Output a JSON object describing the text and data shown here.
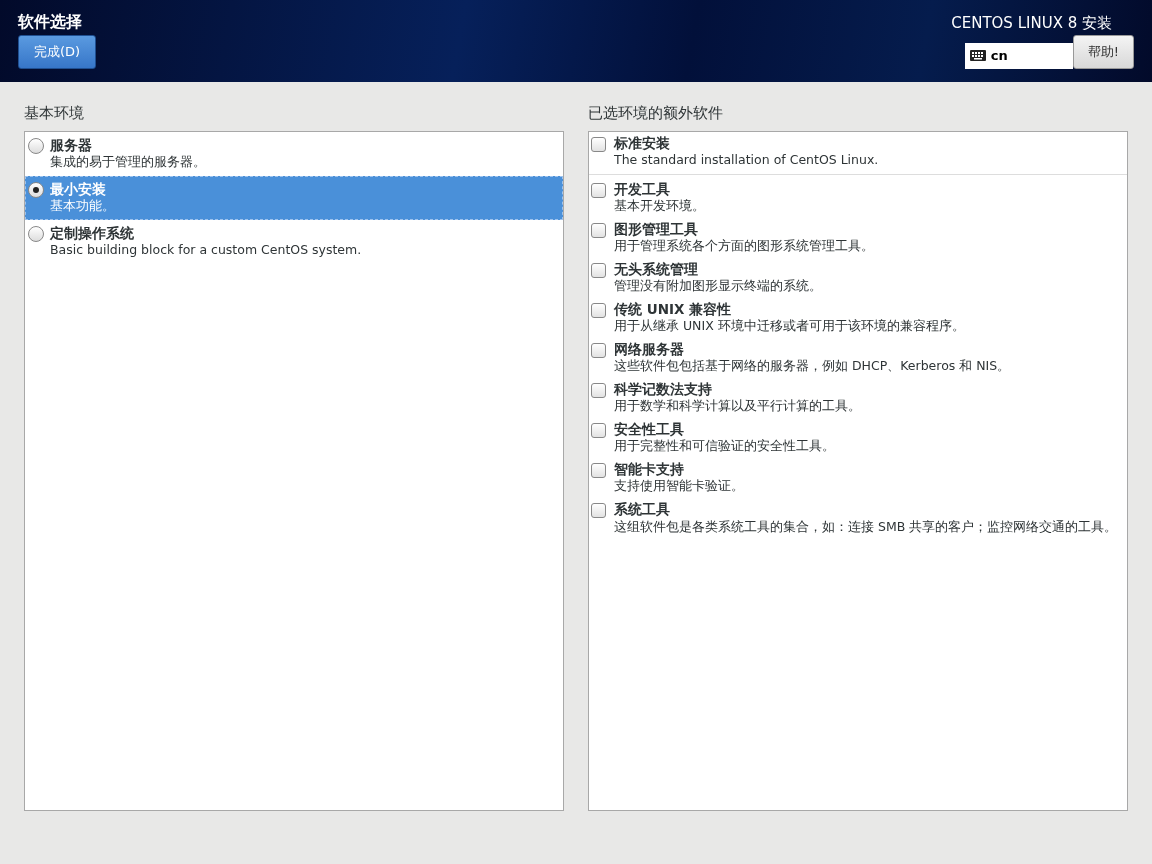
{
  "header": {
    "title": "软件选择",
    "done_button": "完成(D)",
    "product": "CENTOS LINUX 8 安装",
    "keyboard_layout": "cn",
    "help_button": "帮助!"
  },
  "environments": {
    "heading": "基本环境",
    "items": [
      {
        "name": "服务器",
        "description": "集成的易于管理的服务器。",
        "selected": false
      },
      {
        "name": "最小安装",
        "description": "基本功能。",
        "selected": true
      },
      {
        "name": "定制操作系统",
        "description": "Basic building block for a custom CentOS system.",
        "selected": false
      }
    ]
  },
  "addons": {
    "heading": "已选环境的额外软件",
    "groups": [
      [
        {
          "name": "标准安装",
          "description": "The standard installation of CentOS Linux.",
          "checked": false
        }
      ],
      [
        {
          "name": "开发工具",
          "description": "基本开发环境。",
          "checked": false
        },
        {
          "name": "图形管理工具",
          "description": "用于管理系统各个方面的图形系统管理工具。",
          "checked": false
        },
        {
          "name": "无头系统管理",
          "description": "管理没有附加图形显示终端的系统。",
          "checked": false
        },
        {
          "name": "传统 UNIX 兼容性",
          "description": "用于从继承 UNIX 环境中迁移或者可用于该环境的兼容程序。",
          "checked": false
        },
        {
          "name": "网络服务器",
          "description": "这些软件包包括基于网络的服务器，例如 DHCP、Kerberos 和 NIS。",
          "checked": false
        },
        {
          "name": "科学记数法支持",
          "description": "用于数学和科学计算以及平行计算的工具。",
          "checked": false
        },
        {
          "name": "安全性工具",
          "description": "用于完整性和可信验证的安全性工具。",
          "checked": false
        },
        {
          "name": "智能卡支持",
          "description": "支持使用智能卡验证。",
          "checked": false
        },
        {
          "name": "系统工具",
          "description": "这组软件包是各类系统工具的集合，如：连接 SMB 共享的客户；监控网络交通的工具。",
          "checked": false
        }
      ]
    ]
  }
}
